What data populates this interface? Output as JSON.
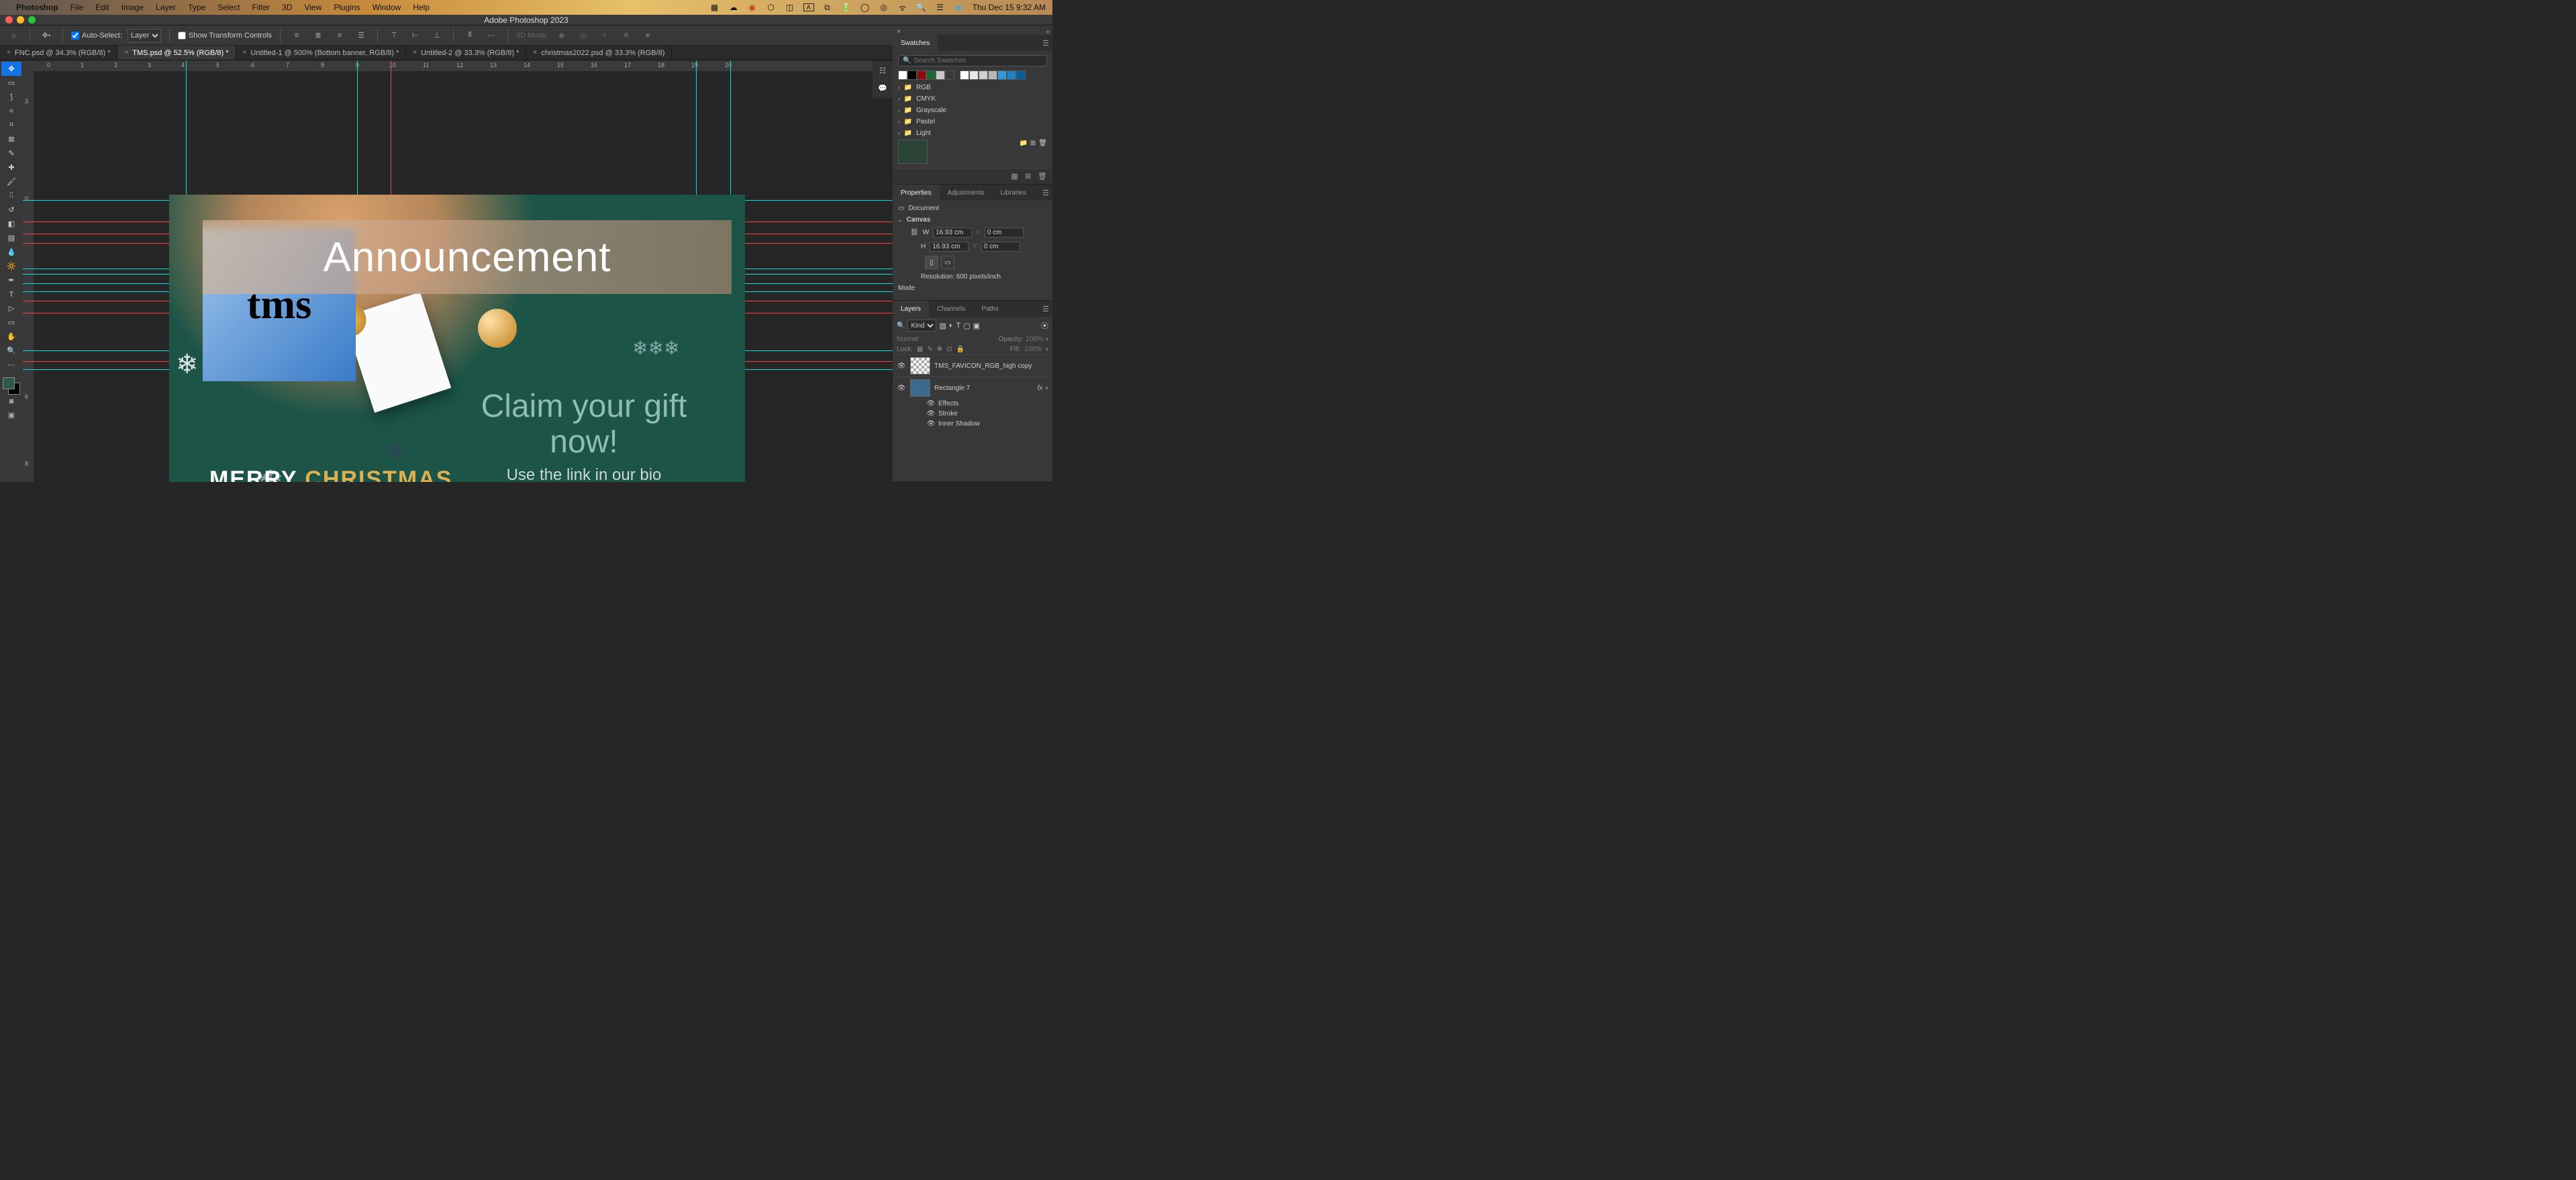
{
  "macmenu": {
    "app": "Photoshop",
    "items": [
      "File",
      "Edit",
      "Image",
      "Layer",
      "Type",
      "Select",
      "Filter",
      "3D",
      "View",
      "Plugins",
      "Window",
      "Help"
    ],
    "clock": "Thu Dec 15  9:32 AM"
  },
  "window": {
    "title": "Adobe Photoshop 2023"
  },
  "options": {
    "autoselect_label": "Auto-Select:",
    "autoselect_kind": "Layer",
    "show_tc": "Show Transform Controls",
    "mode3d": "3D Mode:"
  },
  "tabs": [
    {
      "label": "FNC.psd @ 34.3% (RGB/8) *",
      "active": false
    },
    {
      "label": "TMS.psd @ 52.5% (RGB/8) *",
      "active": true
    },
    {
      "label": "Untitled-1 @ 500% (Bottom banner, RGB/8) *",
      "active": false
    },
    {
      "label": "Untitled-2 @ 33.3% (RGB/8) *",
      "active": false
    },
    {
      "label": "christmas2022.psd @ 33.3% (RGB/8)",
      "active": false
    }
  ],
  "ruler_h": [
    "0",
    "1",
    "2",
    "3",
    "4",
    "5",
    "6",
    "7",
    "8",
    "9",
    "10",
    "11",
    "12",
    "13",
    "14",
    "15",
    "16",
    "17",
    "18",
    "19",
    "20"
  ],
  "ruler_v": [
    "3",
    "0",
    "6",
    "8"
  ],
  "art": {
    "banner": "Announcement",
    "logo": "tms",
    "claim1": "Claim your gift now!",
    "claim2": "Use the link in our bio",
    "merry1": "MERRY",
    "merry2": "CHRISTMAS"
  },
  "swatches": {
    "tab": "Swatches",
    "placeholder": "Search Swatches",
    "colors": [
      "#ffffff",
      "#000000",
      "#8c0b0b",
      "#1a6b33",
      "#c8c8c8",
      "#3a3a3a",
      "#ffffff",
      "#e8e8e8",
      "#d0d0d0",
      "#b8b8b8",
      "#3498db",
      "#1d7fc4",
      "#0b5c9a"
    ],
    "folders": [
      "RGB",
      "CMYK",
      "Grayscale",
      "Pastel",
      "Light"
    ]
  },
  "properties": {
    "tabs": [
      "Properties",
      "Adjustments",
      "Libraries"
    ],
    "doc_label": "Document",
    "canvas_label": "Canvas",
    "W_label": "W",
    "W_val": "16.93 cm",
    "X_label": "X",
    "X_val": "0 cm",
    "H_label": "H",
    "H_val": "16.93 cm",
    "Y_label": "Y",
    "Y_val": "0 cm",
    "res": "Resolution: 600 pixels/inch",
    "mode": "Mode"
  },
  "layers": {
    "tabs": [
      "Layers",
      "Channels",
      "Paths"
    ],
    "kind": "Kind",
    "blend": "Normal",
    "opacity_label": "Opacity:",
    "opacity": "100%",
    "lock_label": "Lock:",
    "fill_label": "Fill:",
    "fill": "100%",
    "items": [
      {
        "name": "TMS_FAVICON_RGB_high copy",
        "sel": false
      },
      {
        "name": "Rectangle 7",
        "sel": false,
        "fx": true
      }
    ],
    "effects_label": "Effects",
    "fx_items": [
      "Stroke",
      "Inner Shadow"
    ]
  }
}
